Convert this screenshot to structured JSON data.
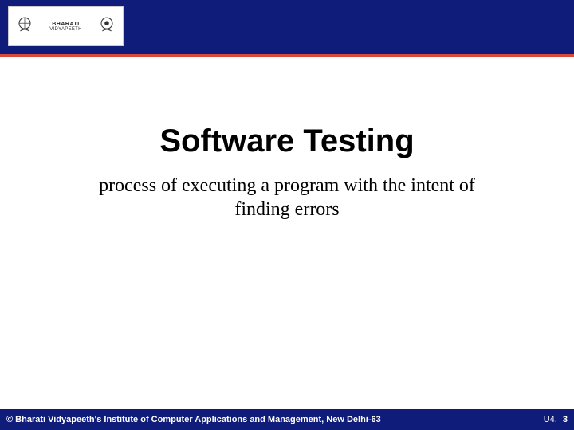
{
  "header": {
    "logo": {
      "text_top": "BHARATI",
      "text_bottom": "VIDYAPEETH",
      "emblem_left_caption": "",
      "emblem_right_caption": ""
    }
  },
  "content": {
    "title": "Software Testing",
    "subtitle": "process of executing a program with the intent of finding errors"
  },
  "footer": {
    "copyright": "© Bharati Vidyapeeth's Institute of Computer Applications and Management, New Delhi-63",
    "unit_label": "U4.",
    "page_number": "3"
  }
}
